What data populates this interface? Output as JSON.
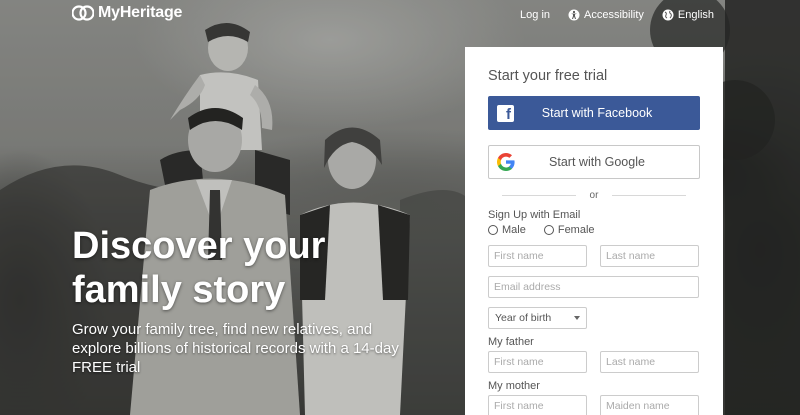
{
  "brand": {
    "name": "MyHeritage"
  },
  "topnav": {
    "login": "Log in",
    "accessibility": "Accessibility",
    "language": "English"
  },
  "hero": {
    "headline_line1": "Discover your",
    "headline_line2": "family story",
    "subhead": "Grow your family tree, find new relatives, and explore billions of historical records with a 14-day FREE trial"
  },
  "signup": {
    "title": "Start your free trial",
    "facebook_label": "Start with Facebook",
    "google_label": "Start with Google",
    "or_label": "or",
    "email_section": "Sign Up with Email",
    "gender_male": "Male",
    "gender_female": "Female",
    "first_name_placeholder": "First name",
    "last_name_placeholder": "Last name",
    "email_placeholder": "Email address",
    "year_of_birth": "Year of birth",
    "father_label": "My father",
    "father_first_placeholder": "First name",
    "father_last_placeholder": "Last name",
    "mother_label": "My mother",
    "mother_first_placeholder": "First name",
    "mother_maiden_placeholder": "Maiden name"
  },
  "colors": {
    "facebook": "#3b5998",
    "panel_bg": "#ffffff",
    "hero_text": "#ffffff"
  }
}
